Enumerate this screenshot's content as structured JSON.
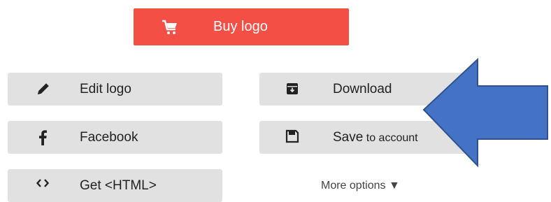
{
  "buy": {
    "label": "Buy logo"
  },
  "buttons": {
    "edit": "Edit logo",
    "download": "Download",
    "facebook": "Facebook",
    "save_main": "Save",
    "save_suffix": " to account",
    "html": "Get <HTML>"
  },
  "more_options": "More options ▼",
  "icons": {
    "cart": "cart-icon",
    "pencil": "pencil-icon",
    "download": "download-box-icon",
    "facebook": "facebook-icon",
    "save": "floppy-disk-icon",
    "code": "code-icon",
    "arrow": "arrow-left-annotation"
  },
  "colors": {
    "buy_bg": "#f44f44",
    "button_bg": "#e1e1e1",
    "arrow_fill": "#4472c4",
    "arrow_stroke": "#2f528f"
  }
}
